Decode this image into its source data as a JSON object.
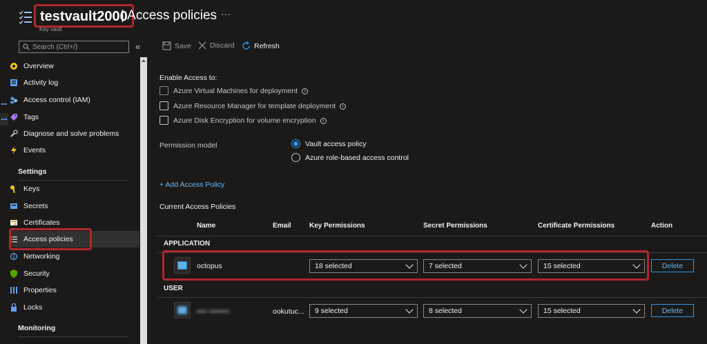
{
  "header": {
    "title_bold": "testvault2000",
    "title_rest": "| Access policies",
    "subtitle": "Key vault",
    "more": "···"
  },
  "search": {
    "placeholder": "Search (Ctrl+/)",
    "collapse": "«"
  },
  "menu": {
    "items_top": [
      {
        "label": "Overview",
        "icon": "overview-icon",
        "color": "#f2c811"
      },
      {
        "label": "Activity log",
        "icon": "activity-log-icon",
        "color": "#5ea0ef"
      },
      {
        "label": "Access control (IAM)",
        "icon": "iam-icon",
        "color": "#5ea0ef"
      },
      {
        "label": "Tags",
        "icon": "tag-icon",
        "color": "#a67af4"
      },
      {
        "label": "Diagnose and solve problems",
        "icon": "wrench-icon",
        "color": "#c8c6c4"
      },
      {
        "label": "Events",
        "icon": "lightning-icon",
        "color": "#f2c811"
      }
    ],
    "settings_label": "Settings",
    "items_settings": [
      {
        "label": "Keys",
        "icon": "key-icon",
        "color": "#f2c811"
      },
      {
        "label": "Secrets",
        "icon": "secret-icon",
        "color": "#5ea0ef"
      },
      {
        "label": "Certificates",
        "icon": "certificate-icon",
        "color": "#e8a13a"
      },
      {
        "label": "Access policies",
        "icon": "list-icon",
        "color": "#c8c6c4"
      },
      {
        "label": "Networking",
        "icon": "networking-icon",
        "color": "#5ea0ef"
      },
      {
        "label": "Security",
        "icon": "shield-icon",
        "color": "#57a300"
      },
      {
        "label": "Properties",
        "icon": "properties-icon",
        "color": "#5ea0ef"
      },
      {
        "label": "Locks",
        "icon": "lock-icon",
        "color": "#5ea0ef"
      }
    ],
    "monitoring_label": "Monitoring"
  },
  "toolbar": {
    "save": "Save",
    "discard": "Discard",
    "refresh": "Refresh"
  },
  "enable_access": {
    "heading": "Enable Access to:",
    "options": [
      {
        "label": "Azure Virtual Machines for deployment",
        "checked": false
      },
      {
        "label": "Azure Resource Manager for template deployment",
        "checked": false
      },
      {
        "label": "Azure Disk Encryption for volume encryption",
        "checked": false
      }
    ]
  },
  "permission_model": {
    "label": "Permission model",
    "options": [
      "Vault access policy",
      "Azure role-based access control"
    ],
    "selected": "Vault access policy"
  },
  "add_policy": "+ Add Access Policy",
  "current_label": "Current Access Policies",
  "table": {
    "headers": [
      "Name",
      "Email",
      "Key Permissions",
      "Secret Permissions",
      "Certificate Permissions",
      "Action"
    ],
    "groups": [
      {
        "label": "APPLICATION",
        "rows": [
          {
            "name": "octopus",
            "email": "",
            "key": "18 selected",
            "secret": "7 selected",
            "cert": "15 selected",
            "action": "Delete"
          }
        ]
      },
      {
        "label": "USER",
        "rows": [
          {
            "name": "•••• ••••••••",
            "email": "ookutuc...",
            "key": "9 selected",
            "secret": "8 selected",
            "cert": "15 selected",
            "action": "Delete"
          }
        ]
      }
    ]
  },
  "colors": {
    "accent": "#2899f5",
    "highlight": "#b0262b",
    "background": "#1b1a19"
  }
}
